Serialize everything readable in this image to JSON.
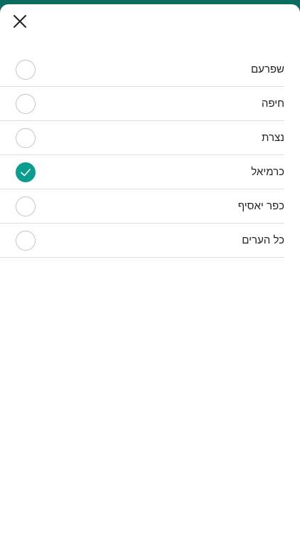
{
  "colors": {
    "header_bar": "#0a6b63",
    "accent": "#0a9c8f",
    "divider": "#dcdcdc",
    "text": "#222222"
  },
  "header": {
    "close_icon": "close-icon"
  },
  "cities": [
    {
      "label": "שפרעם",
      "selected": false
    },
    {
      "label": "חיפה",
      "selected": false
    },
    {
      "label": "נצרת",
      "selected": false
    },
    {
      "label": "כרמיאל",
      "selected": true
    },
    {
      "label": "כפר יאסיף",
      "selected": false
    },
    {
      "label": "כל הערים",
      "selected": false
    }
  ]
}
